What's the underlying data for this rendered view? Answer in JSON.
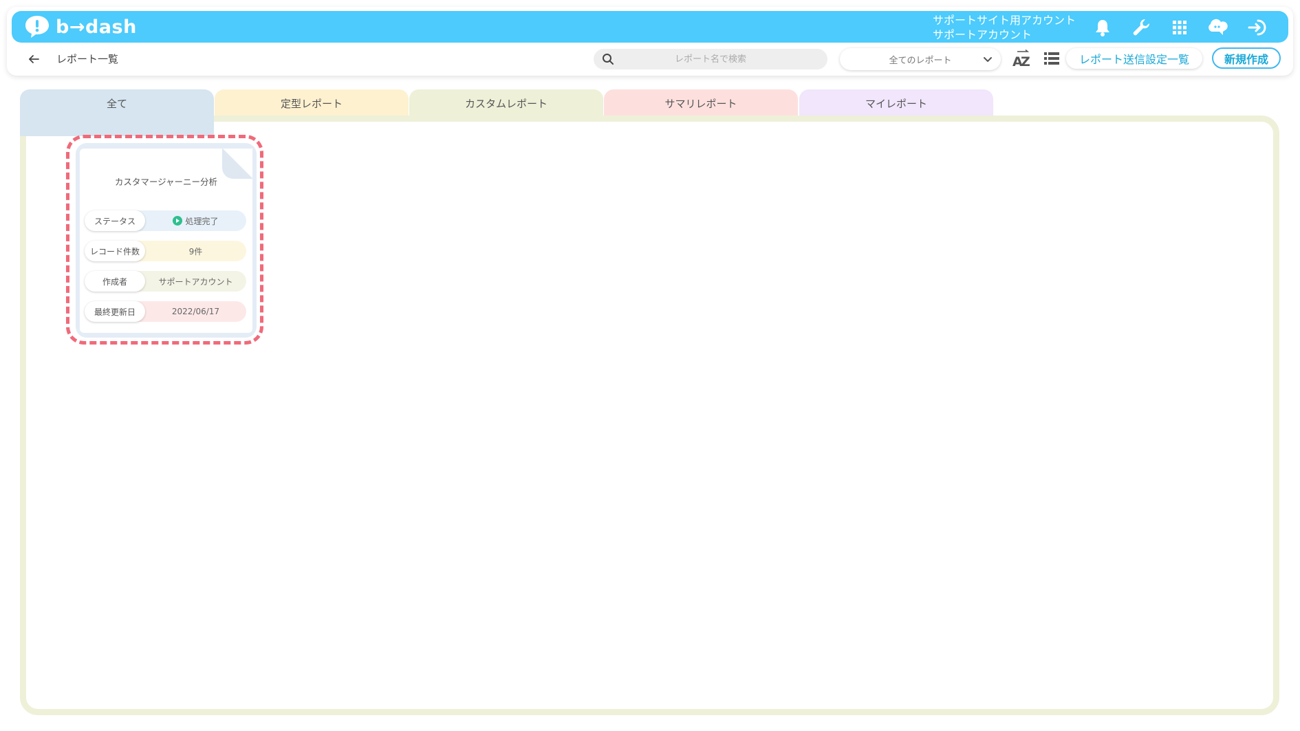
{
  "app": {
    "logo_text": "b→dash",
    "account_line1": "サポートサイト用アカウント",
    "account_line2": "サポートアカウント"
  },
  "header_icons": [
    "bell-icon",
    "wrench-icon",
    "grid-icon",
    "cloud-chat-icon",
    "logout-icon"
  ],
  "toolbar": {
    "page_title": "レポート一覧",
    "search_placeholder": "レポート名で検索",
    "filter_selected": "全てのレポート",
    "send_settings_button": "レポート送信設定一覧",
    "new_button": "新規作成"
  },
  "tabs": [
    {
      "label": "全て",
      "color": "#d6e5f0",
      "active": true
    },
    {
      "label": "定型レポート",
      "color": "#fdf1d0"
    },
    {
      "label": "カスタムレポート",
      "color": "#eef0d8"
    },
    {
      "label": "サマリレポート",
      "color": "#fde0de"
    },
    {
      "label": "マイレポート",
      "color": "#f1e6fb"
    }
  ],
  "report_card": {
    "title": "カスタマージャーニー分析",
    "rows": [
      {
        "label": "ステータス",
        "value": "処理完了",
        "color": "#e8f1f9"
      },
      {
        "label": "レコード件数",
        "value": "9件",
        "color": "#fdf6df"
      },
      {
        "label": "作成者",
        "value": "サポートアカウント",
        "color": "#f3f4e6"
      },
      {
        "label": "最終更新日",
        "value": "2022/06/17",
        "color": "#fde8e8"
      }
    ]
  },
  "colors": {
    "header": "#4ccbfc",
    "accent": "#1aa9d8",
    "highlight": "#f06a7a",
    "status_ok": "#2fbf8f"
  }
}
